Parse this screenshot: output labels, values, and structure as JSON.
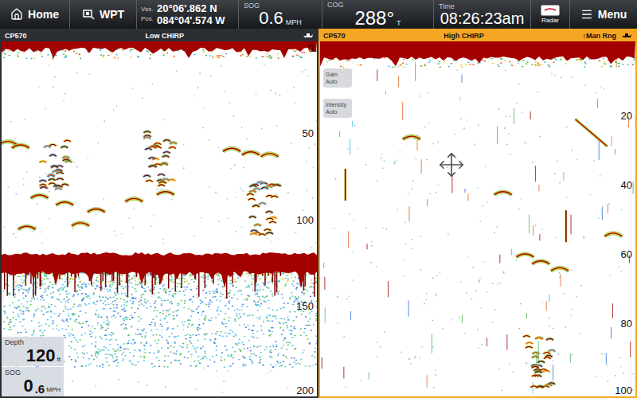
{
  "topbar": {
    "home": {
      "label": "Home"
    },
    "wpt": {
      "label": "WPT"
    },
    "vessel_position": {
      "label_top": "Ves.",
      "label_bottom": "Pos.",
      "lat": "20°06'.862 N",
      "lon": "084°04'.574 W"
    },
    "sog": {
      "label": "SOG",
      "value": "0.6",
      "unit": "MPH"
    },
    "cog": {
      "label": "COG",
      "value": "288°",
      "unit": "T"
    },
    "time": {
      "label": "Time",
      "value": "08:26:23am"
    },
    "radar": {
      "label": "Radar"
    },
    "menu": {
      "label": "Menu"
    }
  },
  "panes": [
    {
      "title": "CP570",
      "mode": "Low CHIRP",
      "selected": false,
      "scale": [
        "0",
        "50",
        "100",
        "150",
        "200"
      ],
      "range_max": 200,
      "bottom_depth": 120,
      "targets": [
        {
          "kind": "arch",
          "x": 0.02,
          "depth": 55
        },
        {
          "kind": "arch",
          "x": 0.06,
          "depth": 57
        },
        {
          "kind": "arch",
          "x": 0.73,
          "depth": 59
        },
        {
          "kind": "arch",
          "x": 0.79,
          "depth": 61
        },
        {
          "kind": "arch",
          "x": 0.85,
          "depth": 62
        },
        {
          "kind": "school",
          "x": 0.17,
          "depth": 66
        },
        {
          "kind": "school",
          "x": 0.5,
          "depth": 64
        },
        {
          "kind": "arch",
          "x": 0.12,
          "depth": 86
        },
        {
          "kind": "arch",
          "x": 0.2,
          "depth": 90
        },
        {
          "kind": "arch",
          "x": 0.3,
          "depth": 94
        },
        {
          "kind": "arch",
          "x": 0.42,
          "depth": 88
        },
        {
          "kind": "arch",
          "x": 0.52,
          "depth": 84
        },
        {
          "kind": "arch",
          "x": 0.08,
          "depth": 104
        },
        {
          "kind": "arch",
          "x": 0.25,
          "depth": 102
        },
        {
          "kind": "school",
          "x": 0.83,
          "depth": 93
        }
      ],
      "readouts": [
        {
          "label": "Depth",
          "value": "120",
          "unit": "ft"
        },
        {
          "label": "SOG",
          "value": "0",
          "fraction": ".6",
          "unit": "MPH"
        }
      ]
    },
    {
      "title": "CP570",
      "mode": "High CHIRP",
      "range_label": "↕Man Rng",
      "selected": true,
      "scale": [
        "20",
        "40",
        "60",
        "80",
        "100"
      ],
      "range_max": 100,
      "targets": [
        {
          "kind": "arch",
          "x": 0.29,
          "depth": 26
        },
        {
          "kind": "streak",
          "x": 0.86,
          "depth": 25
        },
        {
          "kind": "arch",
          "x": 0.58,
          "depth": 42
        },
        {
          "kind": "arch",
          "x": 0.93,
          "depth": 54
        },
        {
          "kind": "arch",
          "x": 0.65,
          "depth": 60
        },
        {
          "kind": "arch",
          "x": 0.7,
          "depth": 62
        },
        {
          "kind": "arch",
          "x": 0.76,
          "depth": 64
        },
        {
          "kind": "vertical",
          "x": 0.08,
          "depth": 40
        },
        {
          "kind": "vertical",
          "x": 0.78,
          "depth": 52
        },
        {
          "kind": "school",
          "x": 0.7,
          "depth": 91
        }
      ],
      "settings": [
        {
          "label": "Gain",
          "value": "Auto"
        },
        {
          "label": "Intensity",
          "value": "Auto"
        }
      ]
    }
  ]
}
